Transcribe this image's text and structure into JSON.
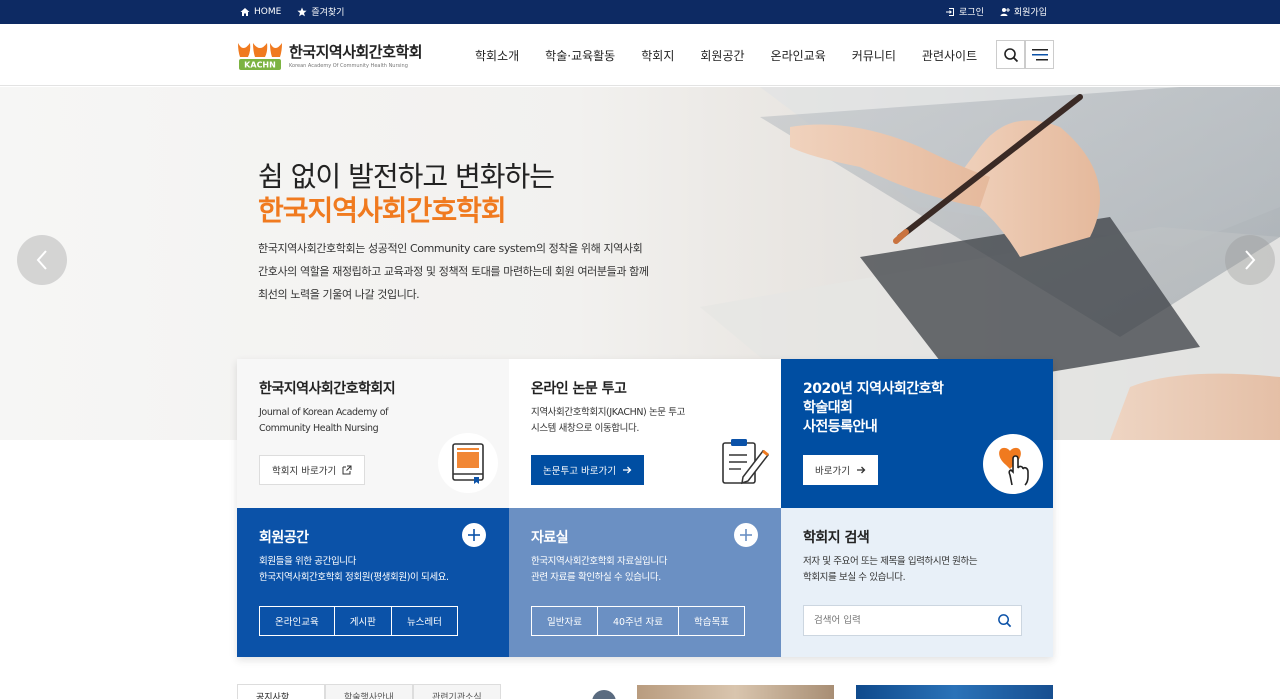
{
  "topbar": {
    "home": "HOME",
    "bookmark": "즐겨찾기",
    "login": "로그인",
    "join": "회원가입"
  },
  "logo": {
    "name": "한국지역사회간호학회",
    "en": "Korean Academy Of Community Health Nursing",
    "mark_text": "KACHN"
  },
  "nav": {
    "items": [
      "학회소개",
      "학술·교육활동",
      "학회지",
      "회원공간",
      "온라인교육",
      "커뮤니티",
      "관련사이트"
    ]
  },
  "hero": {
    "line1": "쉼 없이 발전하고 변화하는",
    "line2": "한국지역사회간호학회",
    "desc_lines": [
      "한국지역사회간호학회는 성공적인 Community care system의 정착을 위해 지역사회",
      "간호사의 역할을 재정립하고 교육과정 및 정책적 토대를 마련하는데 회원 여러분들과 함께",
      "최선의 노력을 기울여 나갈 것입니다."
    ]
  },
  "cards": {
    "journal": {
      "title": "한국지역사회간호학회지",
      "text_lines": [
        "Journal of Korean Academy of",
        "Community Health Nursing"
      ],
      "button": "학회지 바로가기"
    },
    "submit": {
      "title": "온라인 논문 투고",
      "text_lines": [
        "지역사회간호학회지(JKACHN) 논문 투고",
        "시스템 새창으로 이동합니다."
      ],
      "button": "논문투고 바로가기"
    },
    "conference": {
      "title_lines": [
        "2020년 지역사회간호학",
        "학술대회",
        "사전등록안내"
      ],
      "button": "바로가기"
    },
    "members": {
      "title": "회원공간",
      "text_lines": [
        "회원들을 위한 공간입니다",
        "한국지역사회간호학회 정회원(평생회원)이 되세요."
      ],
      "tabs": [
        "온라인교육",
        "게시판",
        "뉴스레터"
      ]
    },
    "archive": {
      "title": "자료실",
      "text_lines": [
        "한국지역사회간호학회 자료실입니다",
        "관련 자료를 확인하실 수 있습니다."
      ],
      "tabs": [
        "일반자료",
        "40주년 자료",
        "학습목표"
      ]
    },
    "search": {
      "title": "학회지 검색",
      "text_lines": [
        "저자 및 주요어 또는 제목을 입력하시면 원하는",
        "학회지를 보실 수 있습니다."
      ],
      "placeholder": "검색어 입력"
    }
  },
  "bottom": {
    "tabs": [
      "공지사항",
      "학술행사안내",
      "관련기관소식"
    ]
  },
  "colors": {
    "navy": "#0d2a63",
    "accent_orange": "#f07a1f",
    "primary_blue": "#004ea2",
    "light_blue": "#6b90c3"
  }
}
